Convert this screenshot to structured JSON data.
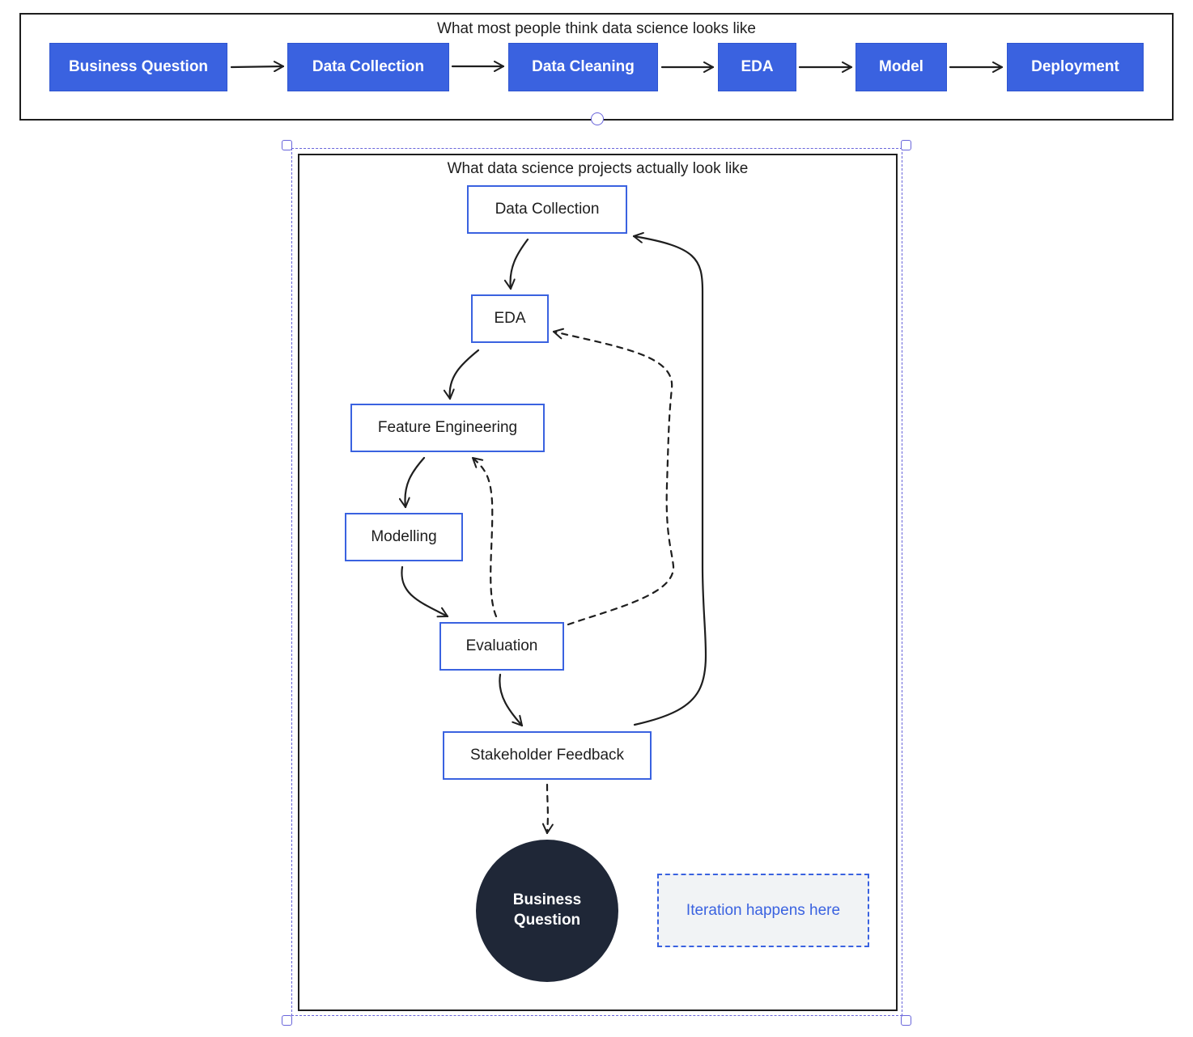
{
  "top_frame": {
    "title": "What most people think data science looks like",
    "steps": [
      "Business Question",
      "Data Collection",
      "Data Cleaning",
      "EDA",
      "Model",
      "Deployment"
    ]
  },
  "bottom_frame": {
    "title": "What data science projects actually look like",
    "nodes": {
      "data_collection": "Data Collection",
      "eda": "EDA",
      "feature_engineering": "Feature Engineering",
      "modelling": "Modelling",
      "evaluation": "Evaluation",
      "stakeholder_feedback": "Stakeholder Feedback",
      "business_question": "Business Question"
    },
    "note": "Iteration happens here"
  },
  "colors": {
    "accent_blue": "#3a62e0",
    "dark_circle": "#1f2737",
    "stroke": "#1e1e1e",
    "selection": "#6965db",
    "note_fill": "#f1f3f5"
  }
}
